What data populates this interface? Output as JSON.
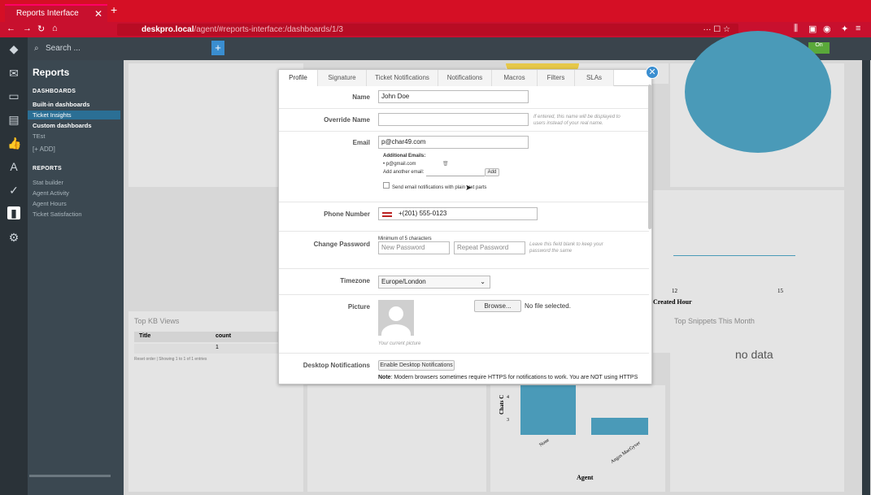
{
  "browser": {
    "tab_title": "Reports Interface",
    "tab_close": "✕",
    "new_tab": "+",
    "url_host": "deskpro.local",
    "url_path": "/agent/#reports-interface:/dashboards/1/3",
    "url_menu": "··· ☐ ☆"
  },
  "topbar": {
    "search_placeholder": "Search ..."
  },
  "sidebar": {
    "title": "Reports",
    "section_dashboards": "DASHBOARDS",
    "items_dashboards": [
      "Built-in dashboards",
      "Ticket Insights",
      "Custom dashboards",
      "TEst",
      "[+ ADD]"
    ],
    "section_reports": "REPORTS",
    "items_reports": [
      "Stat builder",
      "Agent Activity",
      "Agent Hours",
      "Ticket Satisfaction"
    ]
  },
  "background": {
    "top_kb_title": "Top KB Views",
    "table_col_title": "Title",
    "table_col_count": "count",
    "table_value": "1",
    "table_footer": "Reset order | Showing 1 to 1 of 1 entries",
    "chart_x_label": "Created Hour",
    "chart_tick_12": "12",
    "chart_tick_15": "15",
    "snippets_title": "Top Snippets This Month",
    "no_data": "no data",
    "agent_label": "Agent",
    "bar_label_1": "None",
    "bar_label_2": "Angus MacGyver",
    "y_tick_4": "4",
    "y_tick_3": "3",
    "chats_label": "Chats C"
  },
  "modal": {
    "tabs": [
      "Profile",
      "Signature",
      "Ticket Notifications",
      "Notifications",
      "Macros",
      "Filters",
      "SLAs"
    ],
    "active_tab": "Profile",
    "name_label": "Name",
    "name_value": "John Doe",
    "override_label": "Override Name",
    "override_hint": "If entered, this name will be displayed to users instead of your real name.",
    "email_label": "Email",
    "email_value": "p@char49.com",
    "additional_emails_label": "Additional Emails:",
    "additional_email_item": "• p@gmail.com",
    "add_another_label": "Add another email:",
    "add_button": "Add",
    "plain_text_checkbox": "Send email notifications with plain text parts",
    "phone_label": "Phone Number",
    "phone_value": "+(201) 555-0123",
    "password_label": "Change Password",
    "password_min": "Minimum of 5 characters",
    "new_password_ph": "New Password",
    "repeat_password_ph": "Repeat Password",
    "password_hint": "Leave this field blank to keep your password the same",
    "timezone_label": "Timezone",
    "timezone_value": "Europe/London",
    "picture_label": "Picture",
    "browse_button": "Browse...",
    "no_file": "No file selected.",
    "current_picture": "Your current picture",
    "desktop_label": "Desktop Notifications",
    "enable_desktop_button": "Enable Desktop Notifications",
    "note_bold": "Note",
    "note_text": ": Modern browsers sometimes require HTTPS for notifications to work. You are NOT using HTTPS"
  },
  "colors": {
    "chrome_red": "#c8102e",
    "accent_blue": "#3a8ed0",
    "chart_teal": "#4a9ab8"
  }
}
